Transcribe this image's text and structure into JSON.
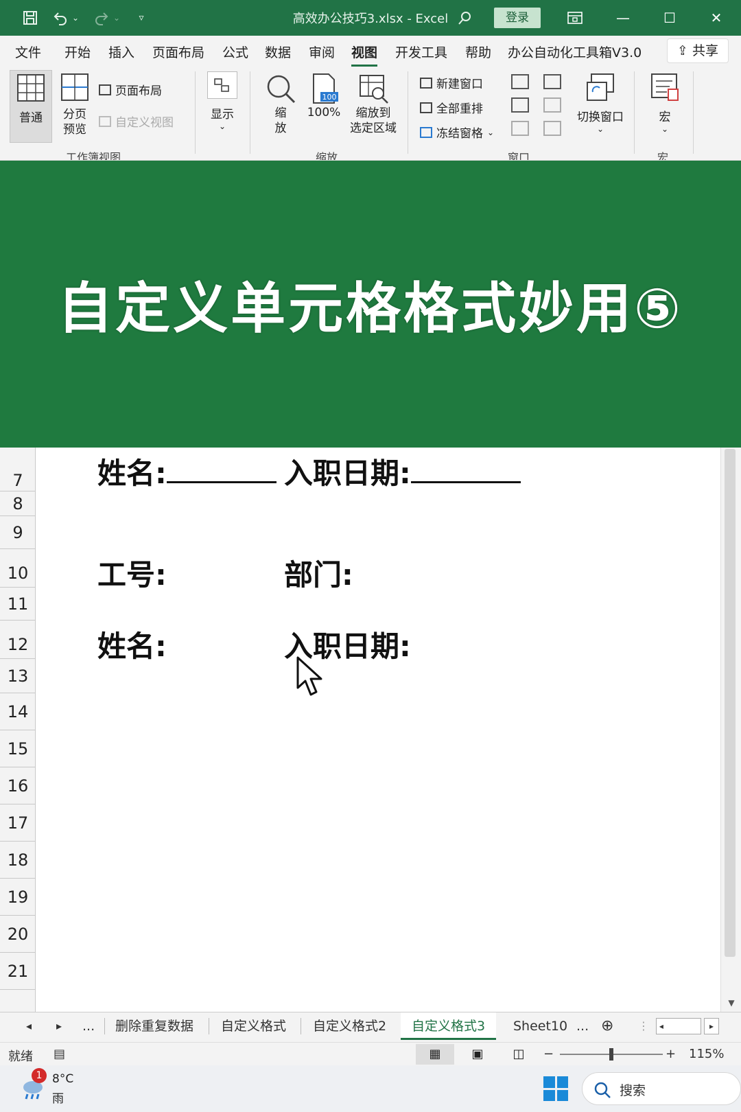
{
  "titlebar": {
    "title": "高效办公技巧3.xlsx  -  Excel",
    "login_label": "登录",
    "icons": [
      "save-icon",
      "undo-icon",
      "redo-icon",
      "customize-icon",
      "search-icon",
      "ribbon-display-icon",
      "minimize-icon",
      "maximize-icon",
      "close-icon"
    ]
  },
  "ribbon_tabs": [
    "文件",
    "开始",
    "插入",
    "页面布局",
    "公式",
    "数据",
    "审阅",
    "视图",
    "开发工具",
    "帮助",
    "办公自动化工具箱V3.0"
  ],
  "active_tab": "视图",
  "share_label": "共享",
  "ribbon": {
    "normal": "普通",
    "page_break_line1": "分页",
    "page_break_line2": "预览",
    "page_layout": "页面布局",
    "custom_views": "自定义视图",
    "group_workbook_views": "工作簿视图",
    "show": "显示",
    "zoom_line1": "缩",
    "zoom_line2": "放",
    "zoom_100": "100%",
    "zoom_sel_line1": "缩放到",
    "zoom_sel_line2": "选定区域",
    "group_zoom": "缩放",
    "new_window": "新建窗口",
    "arrange_all": "全部重排",
    "freeze_panes": "冻结窗格",
    "group_window": "窗口",
    "switch_windows": "切换窗口",
    "macros": "宏",
    "group_macros": "宏"
  },
  "banner": {
    "text": "自定义单元格格式妙用⑤"
  },
  "sheet": {
    "rows": [
      "7",
      "8",
      "9",
      "10",
      "11",
      "12",
      "13",
      "14",
      "15",
      "16",
      "17",
      "18",
      "19",
      "20",
      "21"
    ],
    "name_label_1": "姓名:",
    "hire_date_label_1": "入职日期:",
    "employee_id_label": "工号:",
    "department_label": "部门:",
    "name_label_2": "姓名:",
    "hire_date_label_2": "入职日期:"
  },
  "sheet_tabs": {
    "ellipsis_left": "...",
    "tabs": [
      "删除重复数据",
      "自定义格式",
      "自定义格式2",
      "自定义格式3",
      "Sheet10"
    ],
    "active": "自定义格式3",
    "ellipsis_right": "..."
  },
  "status": {
    "ready": "就绪",
    "zoom_minus": "−",
    "zoom_plus": "+",
    "zoom_level": "115%"
  },
  "taskbar": {
    "notification_count": "1",
    "temperature": "8°C",
    "weather": "雨",
    "search_label": "搜索"
  },
  "colors": {
    "excel_green": "#217346",
    "banner_green": "#1f7a3f",
    "windows_blue": "#1a8ad8"
  }
}
